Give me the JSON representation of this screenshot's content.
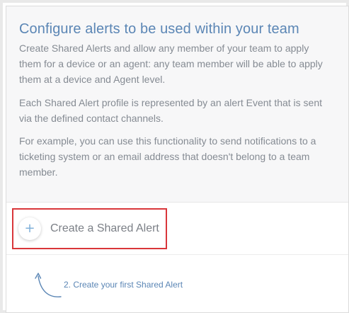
{
  "shared_alerts": {
    "title": "Configure alerts to be used within your team",
    "paragraphs": [
      "Create Shared Alerts and allow any member of your team to apply them for a device or an agent: any team member will be able to apply them at a device and Agent level.",
      "Each Shared Alert profile is represented by an alert Event that is sent via the defined contact channels.",
      "For example, you can use this functionality to send notifications to a ticketing system or an email address that doesn't belong to a team member."
    ],
    "create_button": {
      "icon": "plus-icon",
      "icon_glyph": "+",
      "label": "Create a Shared Alert"
    },
    "hint": {
      "icon": "curved-arrow-up-icon",
      "text": "2. Create your first Shared Alert"
    }
  },
  "colors": {
    "title": "#5b86b5",
    "body_text": "#858b93",
    "highlight_border": "#d9363a",
    "plus_icon": "#7fb0d9",
    "hint": "#5b86b5"
  }
}
